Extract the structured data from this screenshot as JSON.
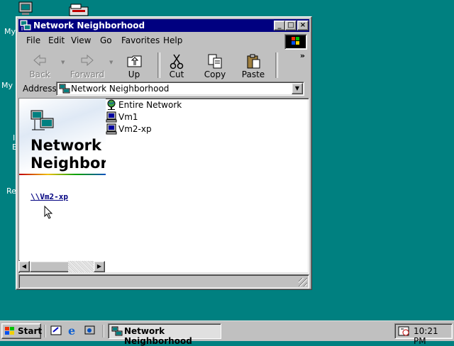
{
  "desktop": {
    "labels": [
      "My",
      "My D",
      "I",
      "E",
      "Re"
    ]
  },
  "window": {
    "title": "Network Neighborhood",
    "controls": {
      "minimize": "_",
      "maximize": "□",
      "close": "×"
    },
    "menu": [
      "File",
      "Edit",
      "View",
      "Go",
      "Favorites",
      "Help"
    ],
    "toolbar": {
      "back": "Back",
      "forward": "Forward",
      "up": "Up",
      "cut": "Cut",
      "copy": "Copy",
      "paste": "Paste",
      "more": "»"
    },
    "address": {
      "label": "Address",
      "value": "Network Neighborhood"
    },
    "left_pane": {
      "title": "Network Neighborhood",
      "link": "\\\\Vm2-xp"
    },
    "items": [
      "Entire Network",
      "Vm1",
      "Vm2-xp"
    ]
  },
  "taskbar": {
    "start": "Start",
    "task": "Network Neighborhood",
    "clock": "10:21 PM"
  }
}
